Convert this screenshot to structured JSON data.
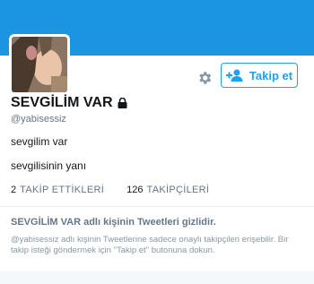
{
  "profile": {
    "name": "SEVGİLİM VAR",
    "handle": "@yabisessiz",
    "bio_line_1": "sevgilim var",
    "bio_line_2": "sevgilisinin yanı"
  },
  "actions": {
    "follow_label": "Takip et",
    "settings_icon": "gear-icon",
    "follow_icon": "add-user-icon"
  },
  "stats": [
    {
      "count": "2",
      "label": "TAKİP ETTİKLERİ"
    },
    {
      "count": "126",
      "label": "TAKİPÇİLERİ"
    }
  ],
  "protected_notice": {
    "title": "SEVGİLİM VAR adlı kişinin Tweetleri gizlidir.",
    "text": "@yabisessiz adlı kişinin Tweetlerine sadece onaylı takipçileri erişebilir. Bir takip isteği göndermek için \"Takip et\" butonuna dokun."
  },
  "colors": {
    "banner": "#1b95e0",
    "accent": "#1da1f2"
  }
}
